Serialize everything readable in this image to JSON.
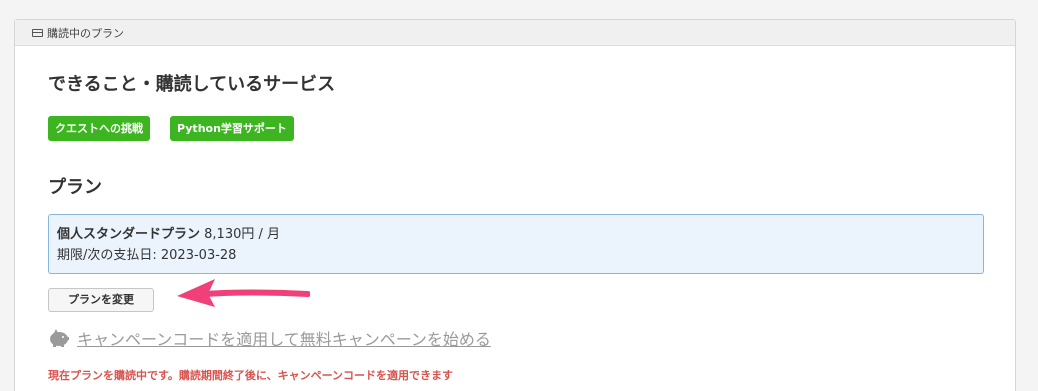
{
  "panel": {
    "title": "購読中のプラン",
    "icon": "credit-card-icon"
  },
  "services": {
    "heading": "できること・購読しているサービス",
    "tags": [
      "クエストへの挑戦",
      "Python学習サポート"
    ],
    "tag_color": "#3cb521"
  },
  "plan": {
    "heading": "プラン",
    "name": "個人スタンダードプラン",
    "price": "8,130円 / 月",
    "next_payment": "期限/次の支払日: 2023-03-28",
    "box_color": "#ebf3fd",
    "border_color": "#88b5e0"
  },
  "change_button": {
    "label": "プランを変更"
  },
  "campaign": {
    "icon": "piggy-bank-icon",
    "link_text": "キャンペーンコードを適用して無料キャンペーンを始める"
  },
  "notice": {
    "text": "現在プランを購読中です。購読期間終了後に、キャンペーンコードを適用できます",
    "color": "#d9534f"
  },
  "annotation": {
    "arrow_color": "#f0407a"
  }
}
